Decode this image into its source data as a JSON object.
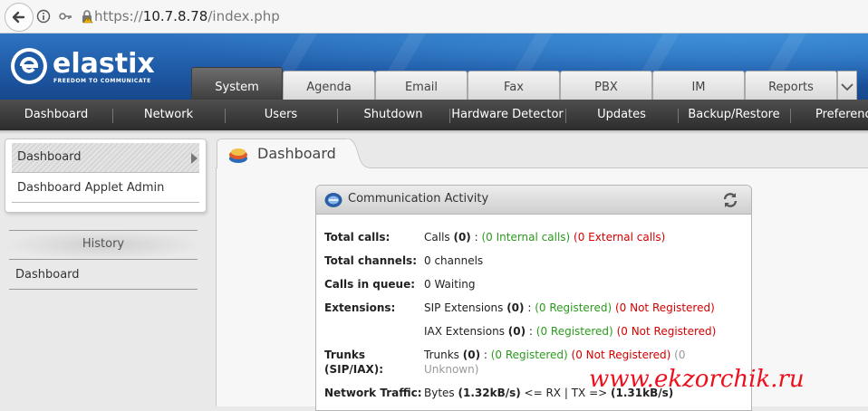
{
  "browser": {
    "url_scheme": "https://",
    "url_host": "10.7.8.78",
    "url_path": "/index.php"
  },
  "brand": {
    "name": "elastix",
    "tagline": "FREEDOM TO COMMUNICATE",
    "accent": "#1f5aa6"
  },
  "main_tabs": [
    {
      "label": "System",
      "active": true
    },
    {
      "label": "Agenda"
    },
    {
      "label": "Email"
    },
    {
      "label": "Fax"
    },
    {
      "label": "PBX"
    },
    {
      "label": "IM"
    },
    {
      "label": "Reports"
    }
  ],
  "sub_nav": [
    "Dashboard",
    "Network",
    "Users",
    "Shutdown",
    "Hardware Detector",
    "Updates",
    "Backup/Restore",
    "Preferences"
  ],
  "sidebar": {
    "items": [
      "Dashboard",
      "Dashboard Applet Admin"
    ],
    "history_title": "History",
    "history_items": [
      "Dashboard"
    ]
  },
  "page": {
    "title": "Dashboard"
  },
  "applet": {
    "title": "Communication Activity",
    "rows": {
      "total_calls": {
        "label": "Total calls:",
        "prefix": "Calls ",
        "count": "(0)",
        "sep": " : ",
        "internal": "(0 Internal calls)",
        "external": "(0 External calls)"
      },
      "total_channels": {
        "label": "Total channels:",
        "text": "0 channels"
      },
      "calls_queue": {
        "label": "Calls in queue:",
        "text": "0 Waiting"
      },
      "extensions": {
        "label": "Extensions:",
        "sip": {
          "prefix": "SIP Extensions ",
          "count": "(0)",
          "sep": " : ",
          "registered": "(0 Registered)",
          "not_registered": "(0 Not Registered)"
        },
        "iax": {
          "prefix": "IAX Extensions ",
          "count": "(0)",
          "sep": " : ",
          "registered": "(0 Registered)",
          "not_registered": "(0 Not Registered)"
        }
      },
      "trunks": {
        "label1": "Trunks",
        "label2": "(SIP/IAX):",
        "prefix": "Trunks ",
        "count": "(0)",
        "sep": " : ",
        "registered": "(0 Registered)",
        "not_registered": "(0 Not Registered)",
        "unknown1": "(0",
        "unknown2": "Unknown)"
      },
      "network": {
        "label": "Network Traffic:",
        "prefix": "Bytes ",
        "rx": "(1.32kB/s)",
        "mid": " <= RX | TX => ",
        "tx": "(1.31kB/s)"
      }
    }
  },
  "watermark": "www.ekzorchik.ru"
}
